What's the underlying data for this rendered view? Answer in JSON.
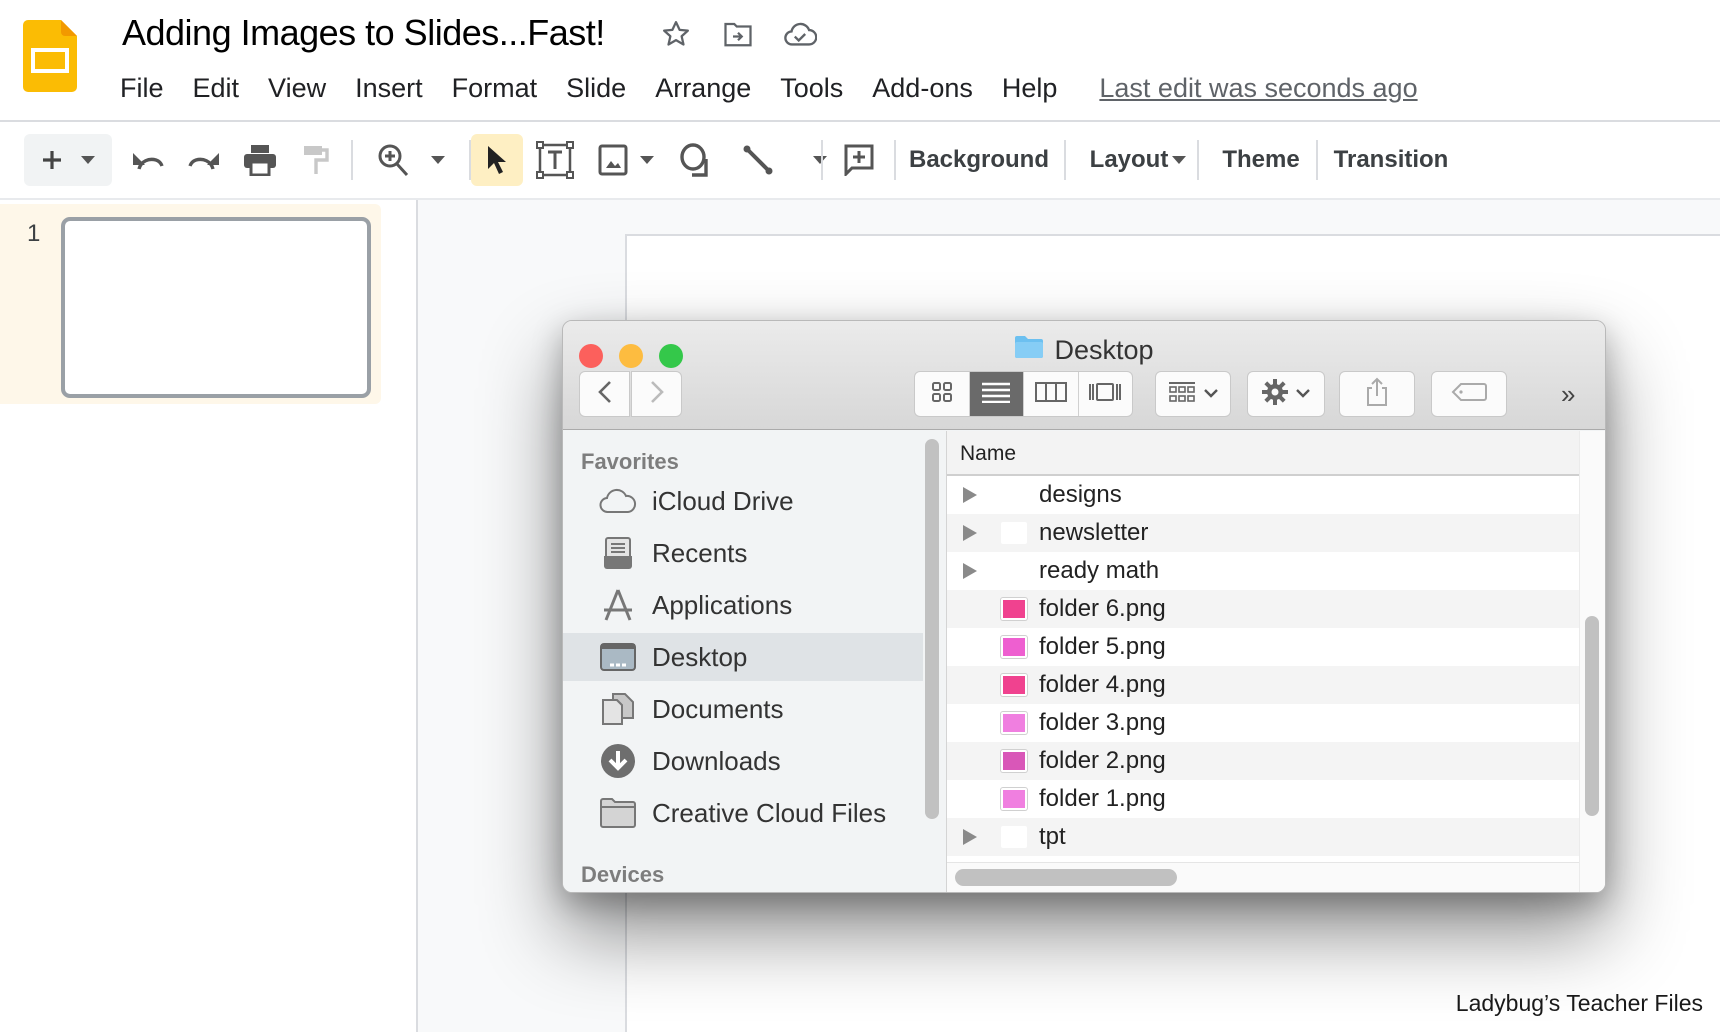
{
  "app": {
    "doc_title": "Adding Images to Slides...Fast!",
    "title_icons": [
      "star-icon",
      "move-to-folder-icon",
      "cloud-saved-icon"
    ],
    "brand_color": "#FBBC04"
  },
  "menu": {
    "items": [
      "File",
      "Edit",
      "View",
      "Insert",
      "Format",
      "Slide",
      "Arrange",
      "Tools",
      "Add-ons",
      "Help"
    ],
    "last_edit": "Last edit was seconds ago"
  },
  "toolbar": {
    "icons": [
      "new-slide-icon",
      "undo-icon",
      "redo-icon",
      "print-icon",
      "paint-format-icon",
      "zoom-icon",
      "select-icon",
      "text-box-icon",
      "image-icon",
      "shape-icon",
      "line-icon",
      "comment-icon"
    ],
    "background_label": "Background",
    "layout_label": "Layout",
    "theme_label": "Theme",
    "transition_label": "Transition",
    "selected_tool": "select"
  },
  "filmstrip": {
    "slides": [
      {
        "number": "1"
      }
    ]
  },
  "watermark": "Ladybug’s Teacher Files",
  "finder": {
    "title": "Desktop",
    "view_mode": "list",
    "more_label": "»",
    "sidebar": {
      "favorites_heading": "Favorites",
      "devices_heading": "Devices",
      "items": [
        {
          "label": "iCloud Drive",
          "icon": "cloud-icon",
          "selected": false
        },
        {
          "label": "Recents",
          "icon": "recents-icon",
          "selected": false
        },
        {
          "label": "Applications",
          "icon": "applications-icon",
          "selected": false
        },
        {
          "label": "Desktop",
          "icon": "desktop-icon",
          "selected": true
        },
        {
          "label": "Documents",
          "icon": "documents-icon",
          "selected": false
        },
        {
          "label": "Downloads",
          "icon": "downloads-icon",
          "selected": false
        },
        {
          "label": "Creative Cloud Files",
          "icon": "folder-icon",
          "selected": false
        }
      ]
    },
    "list": {
      "column_header": "Name",
      "rows": [
        {
          "name": "designs",
          "type": "folder",
          "expandable": true,
          "color": "#ffffff"
        },
        {
          "name": "newsletter",
          "type": "folder",
          "expandable": true,
          "color": "#ffffff"
        },
        {
          "name": "ready math",
          "type": "folder",
          "expandable": true,
          "color": "#ffffff"
        },
        {
          "name": "folder 6.png",
          "type": "image",
          "expandable": false,
          "color": "#F0428F"
        },
        {
          "name": "folder 5.png",
          "type": "image",
          "expandable": false,
          "color": "#EE5FD0"
        },
        {
          "name": "folder 4.png",
          "type": "image",
          "expandable": false,
          "color": "#F0428F"
        },
        {
          "name": "folder 3.png",
          "type": "image",
          "expandable": false,
          "color": "#F07FE0"
        },
        {
          "name": "folder 2.png",
          "type": "image",
          "expandable": false,
          "color": "#D957B8"
        },
        {
          "name": "folder 1.png",
          "type": "image",
          "expandable": false,
          "color": "#F07FE0"
        },
        {
          "name": "tpt",
          "type": "folder",
          "expandable": true,
          "color": "#ffffff"
        }
      ]
    }
  }
}
